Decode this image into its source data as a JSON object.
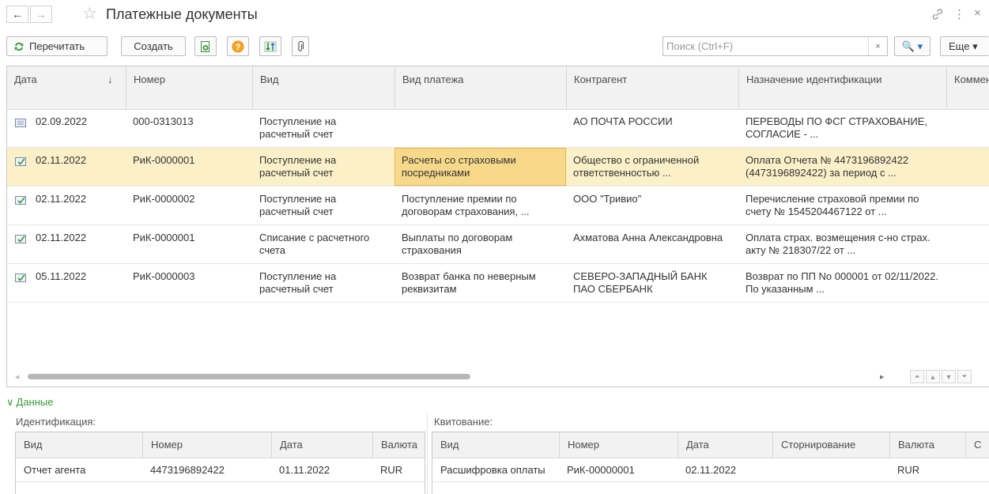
{
  "window": {
    "title": "Платежные документы",
    "back_glyph": "←",
    "forward_glyph": "→",
    "star_glyph": "☆",
    "link_glyph": "🔗",
    "more_glyph": "⋮",
    "close_glyph": "×"
  },
  "toolbar": {
    "reread_label": "Перечитать",
    "create_label": "Создать",
    "search_placeholder": "Поиск (Ctrl+F)",
    "search_value": "",
    "search_clear": "×",
    "search_button": "🔍 ▾",
    "more_label": "Еще ▾"
  },
  "grid": {
    "columns": [
      {
        "label": "Дата",
        "sort": "↓"
      },
      {
        "label": "Номер"
      },
      {
        "label": "Вид"
      },
      {
        "label": "Вид платежа"
      },
      {
        "label": "Контрагент"
      },
      {
        "label": "Назначение идентификации"
      },
      {
        "label": "Коммент"
      }
    ],
    "rows": [
      {
        "date": "02.09.2022",
        "number": "000-0313013",
        "kind": "Поступление на расчетный счет",
        "payment_kind": "",
        "counterparty": "АО ПОЧТА РОССИИ",
        "purpose": "ПЕРЕВОДЫ ПО ФСГ СТРАХОВАНИЕ, СОГЛАСИЕ - ...",
        "comment": ""
      },
      {
        "date": "02.11.2022",
        "number": "РиК-0000001",
        "kind": "Поступление на расчетный счет",
        "payment_kind": "Расчеты со страховыми посредниками",
        "counterparty": "Общество с ограниченной ответственностью ...",
        "purpose": "Оплата Отчета № 4473196892422 (4473196892422) за период с ...",
        "comment": ""
      },
      {
        "date": "02.11.2022",
        "number": "РиК-0000002",
        "kind": "Поступление на расчетный счет",
        "payment_kind": "Поступление премии по договорам страхования, ...",
        "counterparty": "ООО \"Тривио\"",
        "purpose": "Перечисление страховой премии по счету № 1545204467122 от ...",
        "comment": ""
      },
      {
        "date": "02.11.2022",
        "number": "РиК-0000001",
        "kind": "Списание с расчетного счета",
        "payment_kind": "Выплаты по договорам страхования",
        "counterparty": "Ахматова Анна Александровна",
        "purpose": "Оплата страх. возмещения с-но страх. акту № 218307/22 от ...",
        "comment": ""
      },
      {
        "date": "05.11.2022",
        "number": "РиК-0000003",
        "kind": "Поступление на расчетный счет",
        "payment_kind": "Возврат банка по неверным реквизитам",
        "counterparty": "СЕВЕРО-ЗАПАДНЫЙ БАНК ПАО СБЕРБАНК",
        "purpose": "Возврат по ПП No 000001 от 02/11/2022. По указанным ...",
        "comment": ""
      }
    ]
  },
  "details": {
    "section_label": "Данные",
    "identification": {
      "label": "Идентификация:",
      "columns": [
        "Вид",
        "Номер",
        "Дата",
        "Валюта"
      ],
      "rows": [
        {
          "kind": "Отчет агента",
          "number": "4473196892422",
          "date": "01.11.2022",
          "currency": "RUR"
        }
      ]
    },
    "reconciliation": {
      "label": "Квитование:",
      "columns": [
        "Вид",
        "Номер",
        "Дата",
        "Сторнирование",
        "Валюта",
        "С"
      ],
      "rows": [
        {
          "kind": "Расшифровка оплаты",
          "number": "РиК-00000001",
          "date": "02.11.2022",
          "storno": "",
          "currency": "RUR",
          "extra": ""
        }
      ]
    }
  }
}
